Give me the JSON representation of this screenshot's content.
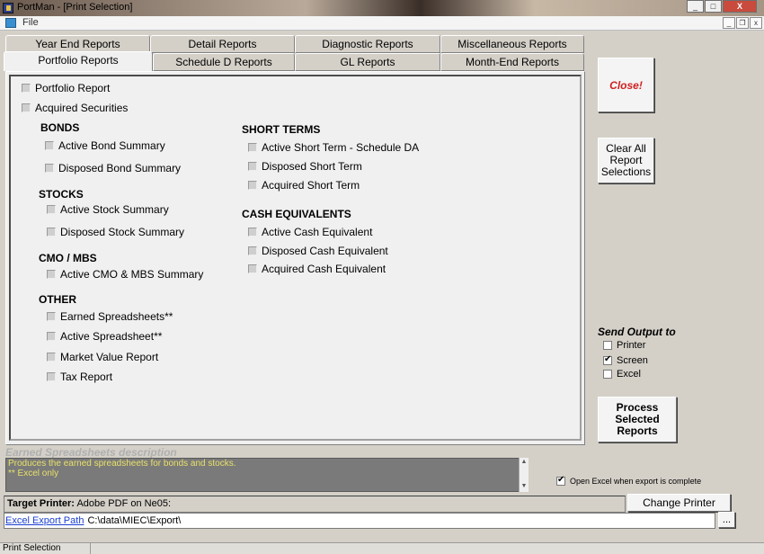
{
  "window": {
    "title": "PortMan - [Print Selection]",
    "minimize": "_",
    "maximize": "□",
    "close": "X"
  },
  "menu": {
    "file": "File"
  },
  "mdi": {
    "minimize": "_",
    "restore": "❐",
    "close": "x"
  },
  "tabs": {
    "row_back": [
      "Year End Reports",
      "Detail Reports",
      "Diagnostic Reports",
      "Miscellaneous Reports"
    ],
    "row_front": [
      "Portfolio Reports",
      "Schedule D Reports",
      "GL Reports",
      "Month-End Reports"
    ]
  },
  "reports": {
    "top": [
      "Portfolio Report",
      "Acquired Securities"
    ],
    "bonds": {
      "header": "BONDS",
      "items": [
        "Active Bond Summary",
        "Disposed Bond Summary"
      ]
    },
    "stocks": {
      "header": "STOCKS",
      "items": [
        "Active Stock Summary",
        "Disposed Stock Summary"
      ]
    },
    "cmo": {
      "header": "CMO / MBS",
      "items": [
        "Active CMO & MBS Summary"
      ]
    },
    "other": {
      "header": "OTHER",
      "items": [
        "Earned Spreadsheets**",
        "Active Spreadsheet**",
        "Market Value Report",
        "Tax Report"
      ]
    },
    "short_terms": {
      "header": "SHORT TERMS",
      "items": [
        "Active Short Term - Schedule DA",
        "Disposed Short Term",
        "Acquired Short Term"
      ]
    },
    "cash": {
      "header": "CASH EQUIVALENTS",
      "items": [
        "Active Cash Equivalent",
        "Disposed Cash Equivalent",
        "Acquired Cash Equivalent"
      ]
    }
  },
  "buttons": {
    "close": "Close!",
    "clear": [
      "Clear All",
      "Report",
      "Selections"
    ],
    "process": [
      "Process",
      "Selected",
      "Reports"
    ],
    "change_printer": "Change Printer",
    "dots": "..."
  },
  "output": {
    "title": "Send Output to",
    "options": [
      {
        "label": "Printer",
        "checked": false
      },
      {
        "label": "Screen",
        "checked": true
      },
      {
        "label": "Excel",
        "checked": false
      }
    ]
  },
  "description": {
    "title": "Earned Spreadsheets description",
    "lines": [
      "Produces the earned spreadsheets for bonds and stocks.",
      "** Excel only"
    ]
  },
  "open_excel": {
    "label": "Open Excel when export is complete",
    "checked": true
  },
  "printer": {
    "label": "Target Printer:",
    "value": "Adobe PDF on Ne05:"
  },
  "export": {
    "link": "Excel Export Path",
    "path": "C:\\data\\MIEC\\Export\\"
  },
  "status": {
    "text": "Print Selection"
  }
}
